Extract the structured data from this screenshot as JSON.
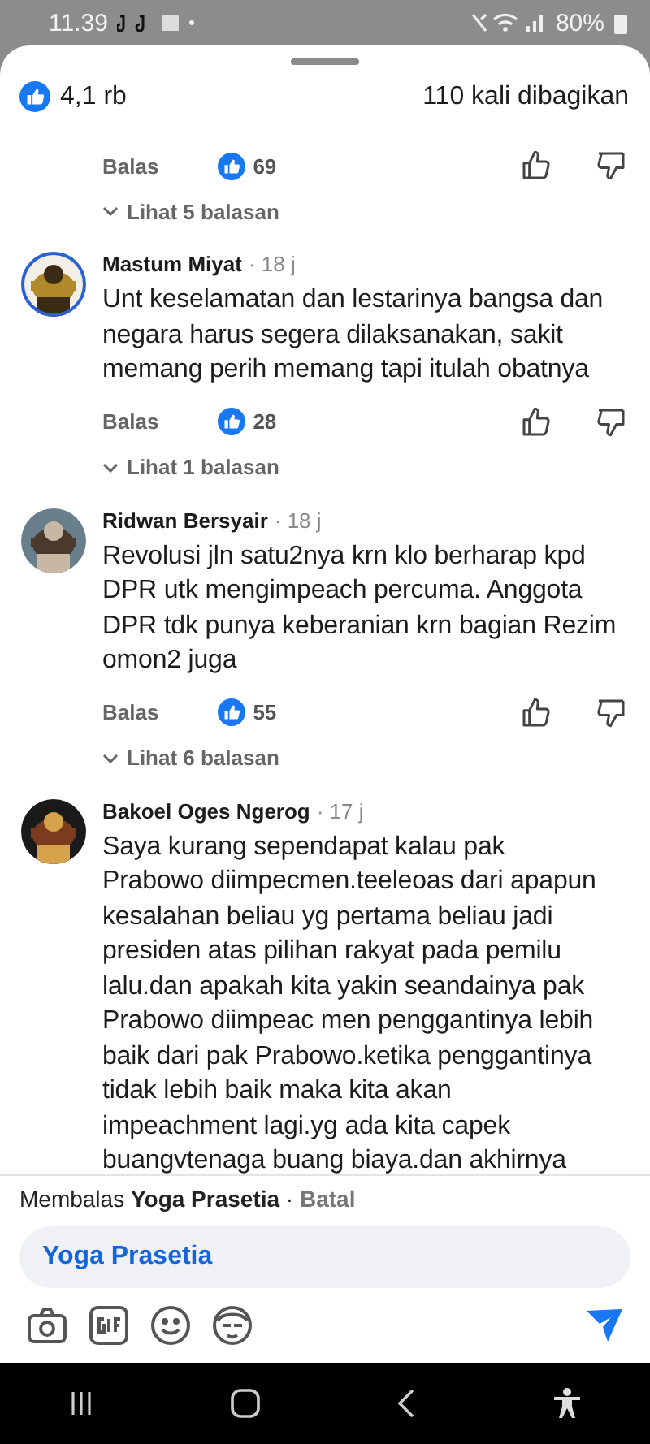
{
  "status_bar": {
    "time": "11.39",
    "battery": "80%"
  },
  "header": {
    "reactions": "4,1 rb",
    "shares": "110 kali dibagikan"
  },
  "comments": [
    {
      "likes": "69",
      "replies": "Lihat 5 balasan",
      "reply_label": "Balas"
    },
    {
      "name": "Mastum Miyat",
      "time": "· 18 j",
      "text": [
        "Unt keselamatan dan lestarinya bangsa dan",
        "negara harus segera dilaksanakan, sakit",
        "memang perih memang tapi itulah obatnya"
      ],
      "likes": "28",
      "replies": "Lihat 1 balasan",
      "reply_label": "Balas"
    },
    {
      "name": "Ridwan Bersyair",
      "time": "· 18 j",
      "text": [
        "Revolusi jln satu2nya krn klo berharap kpd",
        "DPR utk mengimpeach percuma. Anggota",
        "DPR tdk punya keberanian krn bagian Rezim",
        "omon2 juga"
      ],
      "likes": "55",
      "replies": "Lihat 6 balasan",
      "reply_label": "Balas"
    },
    {
      "name": "Bakoel Oges Ngerog",
      "time": "· 17 j",
      "text": [
        "Saya kurang sependapat kalau pak",
        "Prabowo diimpecmen.teeleoas dari apapun",
        "kesalahan beliau yg pertama beliau jadi",
        "presiden atas pilihan rakyat pada pemilu",
        "lalu.dan apakah kita yakin seandainya pak",
        "Prabowo diimpeac men penggantinya lebih",
        "baik dari pak Prabowo.ketika penggantinya",
        "tidak lebih baik maka kita akan",
        "impeachment lagi.yg ada kita capek",
        "buangvtenaga buang biaya.dan akhirnya"
      ]
    }
  ],
  "reply_bar": {
    "text": "Membalas **Yoga Prasetia** · ",
    "cancel": "Batal",
    "input_value": "Yoga Prasetia"
  }
}
